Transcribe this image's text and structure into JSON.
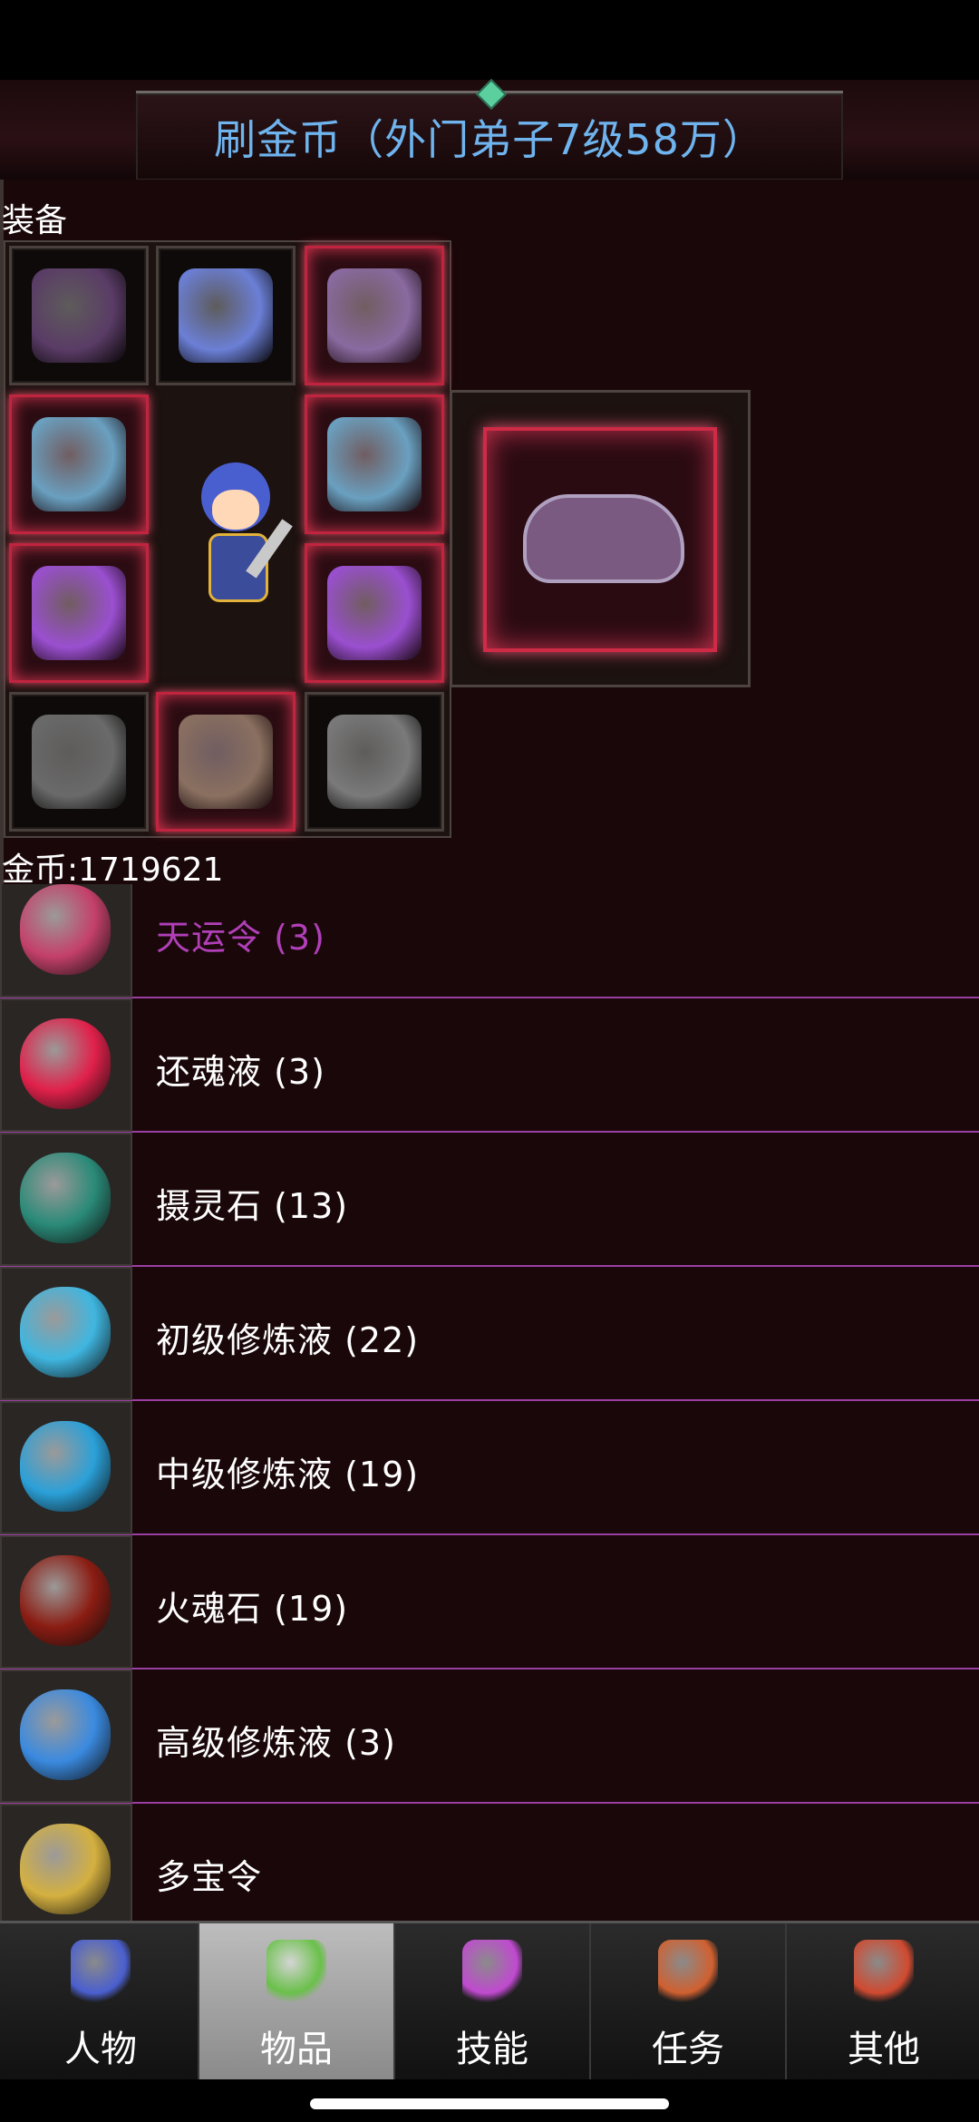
{
  "header": {
    "title": "刷金币（外门弟子7级58万）"
  },
  "equipment": {
    "section_label": "装备",
    "slots": [
      {
        "icon": "hat-icon",
        "rare": false,
        "color": "#5a3c66"
      },
      {
        "icon": "robe-icon",
        "rare": false,
        "color": "#6b7fd6"
      },
      {
        "icon": "helmet-icon",
        "rare": true,
        "color": "#8a6aa0"
      },
      {
        "icon": "sword-icon",
        "rare": true,
        "color": "#6aa0c0"
      },
      {
        "icon": "sword-icon",
        "rare": true,
        "color": "#6aa0c0"
      },
      {
        "icon": "armor-icon",
        "rare": true,
        "color": "#9a4fd0"
      },
      {
        "icon": "armor-icon",
        "rare": true,
        "color": "#9a4fd0"
      },
      {
        "icon": "bracer-icon",
        "rare": false,
        "color": "#6a6a6a"
      },
      {
        "icon": "boots-icon",
        "rare": true,
        "color": "#8a7060"
      },
      {
        "icon": "beads-icon",
        "rare": false,
        "color": "#7a7a7a"
      }
    ],
    "mount_icon": "mount-creature-icon"
  },
  "currency": {
    "gold_text": "金币:1719621"
  },
  "items": [
    {
      "name": "天运令 (3)",
      "icon": "fortune-token-icon",
      "color": "#c4406a",
      "purple": true
    },
    {
      "name": "还魂液 (3)",
      "icon": "red-potion-icon",
      "color": "#e0204a",
      "purple": false
    },
    {
      "name": "摄灵石 (13)",
      "icon": "green-egg-stone-icon",
      "color": "#2a8a78",
      "purple": false
    },
    {
      "name": "初级修炼液 (22)",
      "icon": "blue-vial-icon",
      "color": "#3fb6e0",
      "purple": false
    },
    {
      "name": "中级修炼液 (19)",
      "icon": "flask-icon",
      "color": "#2aa0d8",
      "purple": false
    },
    {
      "name": "火魂石 (19)",
      "icon": "fire-stone-icon",
      "color": "#8a1c12",
      "purple": false
    },
    {
      "name": "高级修炼液 (3)",
      "icon": "winged-bottle-icon",
      "color": "#3a8ae0",
      "purple": false
    },
    {
      "name": "多宝令",
      "icon": "gold-token-icon",
      "color": "#d4b040",
      "purple": false
    }
  ],
  "tabs": [
    {
      "label": "人物",
      "icon": "character-icon",
      "color": "#4a5fcf",
      "active": false
    },
    {
      "label": "物品",
      "icon": "potion-icon",
      "color": "#6ac04a",
      "active": true
    },
    {
      "label": "技能",
      "icon": "skill-orb-icon",
      "color": "#c04ad0",
      "active": false
    },
    {
      "label": "任务",
      "icon": "quest-flag-icon",
      "color": "#d06030",
      "active": false
    },
    {
      "label": "其他",
      "icon": "other-weapon-icon",
      "color": "#d04a30",
      "active": false
    }
  ]
}
